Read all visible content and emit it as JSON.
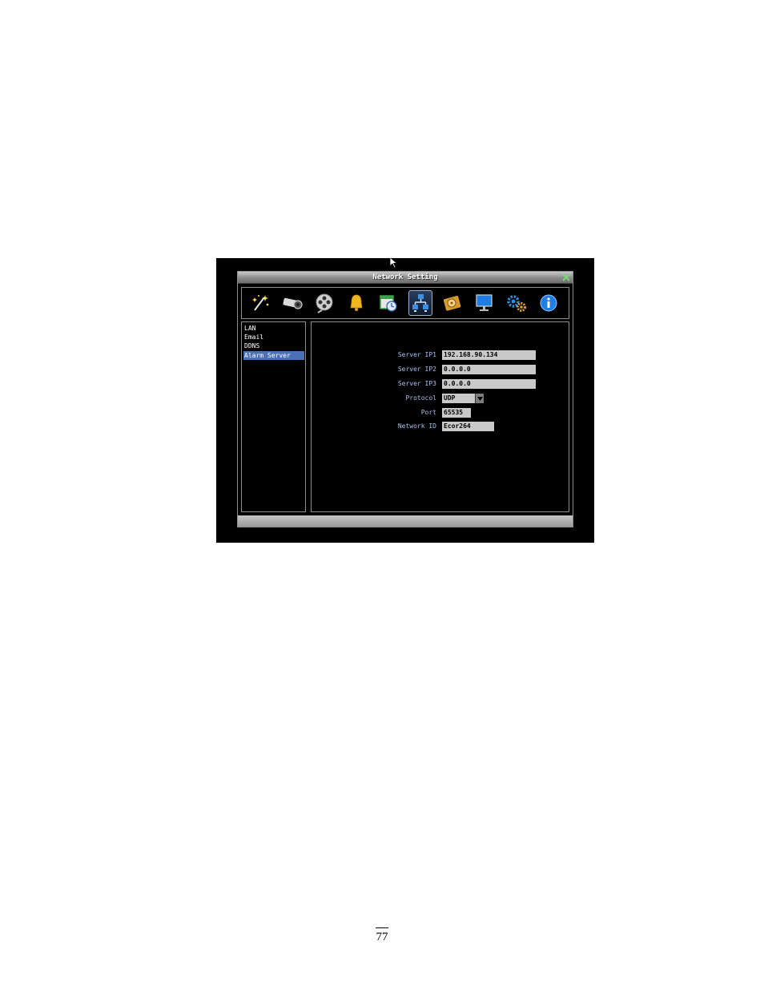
{
  "window": {
    "title": "Network Setting"
  },
  "toolbar": {
    "items": [
      {
        "icon": "wizard-wand-icon"
      },
      {
        "icon": "camera-icon"
      },
      {
        "icon": "film-reel-icon"
      },
      {
        "icon": "bell-icon"
      },
      {
        "icon": "schedule-clock-icon"
      },
      {
        "icon": "network-icon",
        "active": true
      },
      {
        "icon": "hard-disk-icon"
      },
      {
        "icon": "monitor-icon"
      },
      {
        "icon": "gears-icon"
      },
      {
        "icon": "info-icon"
      }
    ]
  },
  "sidebar": {
    "items": [
      {
        "label": "LAN"
      },
      {
        "label": "Email"
      },
      {
        "label": "DDNS"
      },
      {
        "label": "Alarm Server",
        "selected": true
      }
    ]
  },
  "form": {
    "server_ip1": {
      "label": "Server IP1",
      "value": "192.168.90.134"
    },
    "server_ip2": {
      "label": "Server IP2",
      "value": "0.0.0.0"
    },
    "server_ip3": {
      "label": "Server IP3",
      "value": "0.0.0.0"
    },
    "protocol": {
      "label": "Protocol",
      "value": "UDP"
    },
    "port": {
      "label": "Port",
      "value": "65535"
    },
    "network_id": {
      "label": "Network ID",
      "value": "Ecor264"
    }
  },
  "page": {
    "number": "77"
  },
  "colors": {
    "screen_bg": "#000000",
    "label_text": "#a9c3ec",
    "selection": "#4a71b8",
    "field_bg": "#c9c9c9"
  }
}
